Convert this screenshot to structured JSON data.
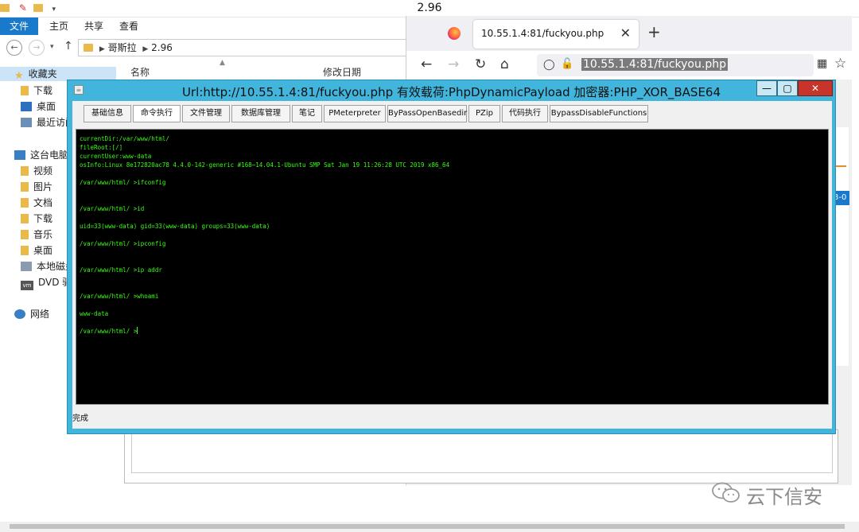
{
  "explorer": {
    "window_title": "2.96",
    "ribbon_tabs": [
      "文件",
      "主页",
      "共享",
      "查看"
    ],
    "breadcrumb": [
      "哥斯拉",
      "2.96"
    ],
    "columns": [
      "名称",
      "修改日期"
    ],
    "nav": {
      "favorites": "收藏夹",
      "fav_items": [
        "下载",
        "桌面",
        "最近访问"
      ],
      "this_pc": "这台电脑",
      "pc_items": [
        "视频",
        "图片",
        "文档",
        "下载",
        "音乐",
        "桌面",
        "本地磁盘",
        "DVD 驱"
      ],
      "network": "网络"
    }
  },
  "firefox": {
    "tab_title": "10.55.1.4:81/fuckyou.php",
    "url": "10.55.1.4:81/fuckyou.php",
    "side_text": "3-0"
  },
  "behinder": {
    "title": "Url:http://10.55.1.4:81/fuckyou.php 有效载荷:PhpDynamicPayload 加密器:PHP_XOR_BASE64",
    "tabs": [
      "基础信息",
      "命令执行",
      "文件管理",
      "数据库管理",
      "笔记",
      "PMeterpreter",
      "ByPassOpenBasedir",
      "PZip",
      "代码执行",
      "BypassDisableFunctions"
    ],
    "terminal_lines": [
      "currentDir:/var/www/html/",
      "fileRoot:[/]",
      "currentUser:www-data",
      "osInfo:Linux 8e172820ac78 4.4.0-142-generic #168~14.04.1-Ubuntu SMP Sat Jan 19 11:26:28 UTC 2019 x86_64",
      "/var/www/html/ >ifconfig",
      "/var/www/html/ >id",
      "uid=33(www-data) gid=33(www-data) groups=33(www-data)",
      "/var/www/html/ >ipconfig",
      "/var/www/html/ >ip addr",
      "/var/www/html/ >whoami",
      "www-data",
      "/var/www/html/ >"
    ],
    "status": "完成"
  },
  "watermark": {
    "text": "云下信安"
  },
  "colors": {
    "terminal_text": "#39ff14",
    "behinder_frame": "#41b5dc",
    "ribbon_active": "#1979ca",
    "close_button": "#c7352a"
  }
}
